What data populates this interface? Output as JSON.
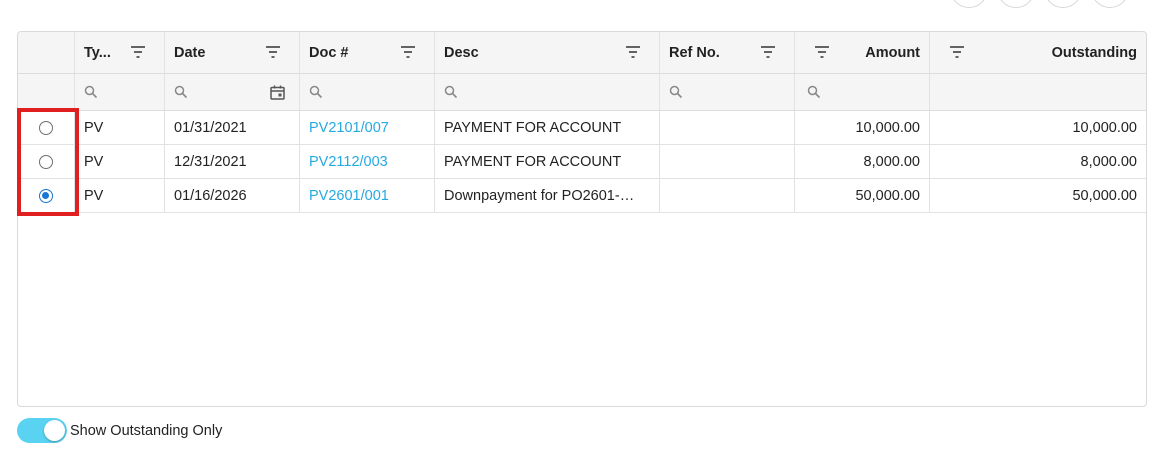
{
  "colors": {
    "link": "#26a9e0",
    "radio_selected": "#1976d2",
    "toggle_on": "#5ad3f2",
    "highlight": "#e02020"
  },
  "columns": [
    {
      "key": "select",
      "label": ""
    },
    {
      "key": "type",
      "label": "Ty..."
    },
    {
      "key": "date",
      "label": "Date"
    },
    {
      "key": "doc",
      "label": "Doc #"
    },
    {
      "key": "desc",
      "label": "Desc"
    },
    {
      "key": "ref",
      "label": "Ref No."
    },
    {
      "key": "amount",
      "label": "Amount"
    },
    {
      "key": "outstanding",
      "label": "Outstanding"
    }
  ],
  "rows": [
    {
      "selected": false,
      "type": "PV",
      "date": "01/31/2021",
      "doc": "PV2101/007",
      "desc": "PAYMENT FOR ACCOUNT",
      "ref": "",
      "amount": "10,000.00",
      "outstanding": "10,000.00"
    },
    {
      "selected": false,
      "type": "PV",
      "date": "12/31/2021",
      "doc": "PV2112/003",
      "desc": "PAYMENT FOR ACCOUNT",
      "ref": "",
      "amount": "8,000.00",
      "outstanding": "8,000.00"
    },
    {
      "selected": true,
      "type": "PV",
      "date": "01/16/2026",
      "doc": "PV2601/001",
      "desc": "Downpayment for PO2601-…",
      "ref": "",
      "amount": "50,000.00",
      "outstanding": "50,000.00"
    }
  ],
  "toggle": {
    "label": "Show Outstanding Only",
    "on": true
  }
}
